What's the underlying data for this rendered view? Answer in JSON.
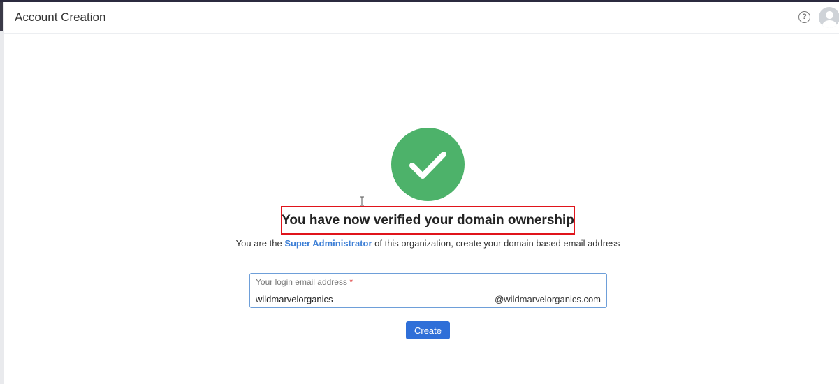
{
  "header": {
    "title": "Account Creation",
    "help_glyph": "?",
    "help_icon": "question-circle-icon",
    "avatar_icon": "user-avatar-icon"
  },
  "success": {
    "icon": "check-icon",
    "circle_color": "#4db26a",
    "heading": "You have now verified your domain ownership",
    "highlight_color": "#e0141b"
  },
  "subtext": {
    "before": "You are the ",
    "link": "Super Administrator",
    "after": " of this organization, create your domain based email address"
  },
  "email_field": {
    "label": "Your login email address",
    "required_marker": "*",
    "value": "wildmarvelorganics",
    "domain": "@wildmarvelorganics.com"
  },
  "actions": {
    "create_label": "Create",
    "accent_color": "#2f6fd8"
  }
}
